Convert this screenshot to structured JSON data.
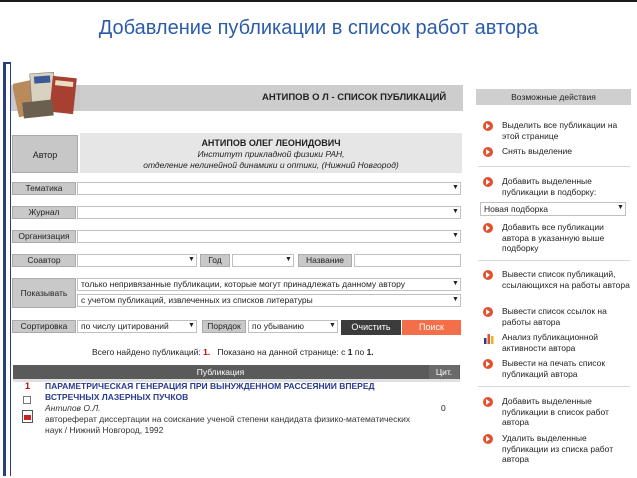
{
  "slide": {
    "title": "Добавление публикации в список работ автора"
  },
  "header": {
    "title": "АНТИПОВ О Л - СПИСОК ПУБЛИКАЦИЙ"
  },
  "author": {
    "tab_label": "Автор",
    "name": "АНТИПОВ ОЛЕГ ЛЕОНИДОВИЧ",
    "institute": "Институт прикладной физики РАН,",
    "department": "отделение нелинейной динамики и оптики, (Нижний Новгород)"
  },
  "filters": {
    "theme_label": "Тематика",
    "journal_label": "Журнал",
    "org_label": "Организация",
    "coauthor_label": "Соавтор",
    "year_label": "Год",
    "name_label": "Название",
    "show_label": "Показывать",
    "show_option_1": "только непривязанные публикации, которые могут принадлежать данному автору",
    "show_option_2": "с учетом публикаций, извлеченных из списков литературы",
    "sort_label": "Сортировка",
    "sort_value": "по числу цитирований",
    "order_label": "Порядок",
    "order_value": "по убыванию",
    "clear_button": "Очистить",
    "search_button": "Поиск"
  },
  "summary": {
    "found_label": "Всего найдено публикаций:",
    "found_count": "1.",
    "shown_label": "Показано на данной странице: с",
    "shown_from": "1",
    "shown_to_label": "по",
    "shown_to": "1."
  },
  "table": {
    "col_publication": "Публикация",
    "col_citations": "Цит.",
    "rows": [
      {
        "num": "1",
        "title": "ПАРАМЕТРИЧЕСКАЯ ГЕНЕРАЦИЯ ПРИ ВЫНУЖДЕННОМ РАССЕЯНИИ ВПЕРЕД ВСТРЕЧНЫХ ЛАЗЕРНЫХ ПУЧКОВ",
        "author": "Антипов О.Л.",
        "description": "автореферат диссертации на соискание ученой степени кандидата физико-математических наук / Нижний Новгород, 1992",
        "citations": "0"
      }
    ]
  },
  "actions": {
    "header": "Возможные действия",
    "select_all": "Выделить все публикации на этой странице",
    "deselect": "Снять выделение",
    "add_to_selection": "Добавить выделенные публикации в подборку:",
    "new_selection": "Новая подборка",
    "add_all_to_list": "Добавить все публикации автора в указанную выше подборку",
    "print_citing": "Вывести список публикаций, ссылающихся на работы автора",
    "print_refs": "Вывести список ссылок на работы автора",
    "analysis": "Анализ публикационной активности автора",
    "print_list": "Вывести на печать список публикаций автора",
    "add_to_author_list": "Добавить выделенные публикации в список работ автора",
    "remove_from_author_list": "Удалить выделенные публикации из списка работ автора"
  },
  "colors": {
    "title_blue": "#2a5cab",
    "accent_red": "#f46e4a",
    "icon_red": "#e2502e",
    "link_navy": "#2a3b8f"
  }
}
